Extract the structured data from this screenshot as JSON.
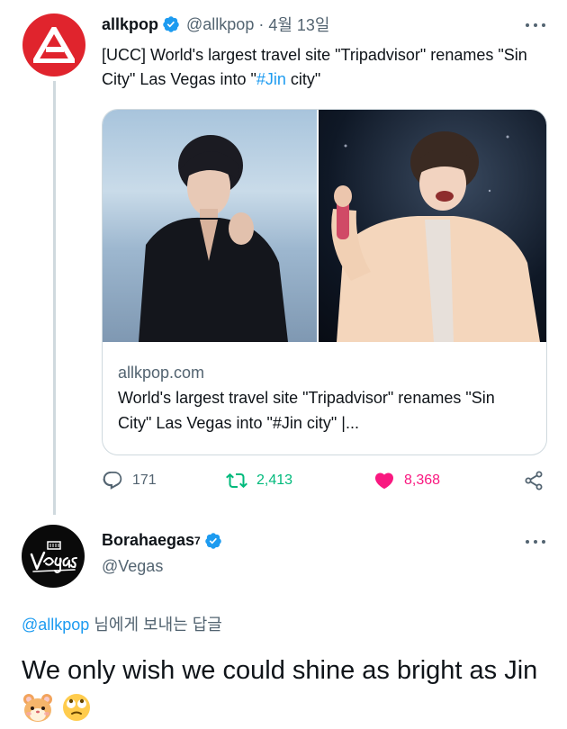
{
  "tweet1": {
    "name": "allkpop",
    "handle": "@allkpop",
    "separator": "·",
    "date": "4월 13일",
    "text_before": "[UCC] World's largest travel site \"Tripadvisor\" renames \"Sin City\" Las Vegas into \"",
    "hashtag": "#Jin",
    "text_after": " city\"",
    "card": {
      "domain": "allkpop.com",
      "title": "World's largest travel site \"Tripadvisor\" renames \"Sin City\" Las Vegas into \"#Jin city\" |..."
    },
    "replies": "171",
    "retweets": "2,413",
    "likes": "8,368",
    "colors": {
      "retweet": "#00ba7c",
      "like": "#f91880",
      "accent": "#1d9bf0",
      "avatar": "#e0242d"
    }
  },
  "tweet2": {
    "name": "Borahaegas",
    "name_suffix": "7",
    "handle": "@Vegas",
    "reply_mention": "@allkpop",
    "reply_suffix": " 님에게 보내는 답글",
    "text": "We only wish we could shine as bright as Jin",
    "emojis": [
      "hamster-face",
      "face-with-rolling-eyes"
    ]
  },
  "icons": {
    "verified": "verified-badge-icon",
    "more": "more-dots-icon",
    "reply": "reply-icon",
    "retweet": "retweet-icon",
    "like": "like-heart-icon",
    "share": "share-icon"
  }
}
